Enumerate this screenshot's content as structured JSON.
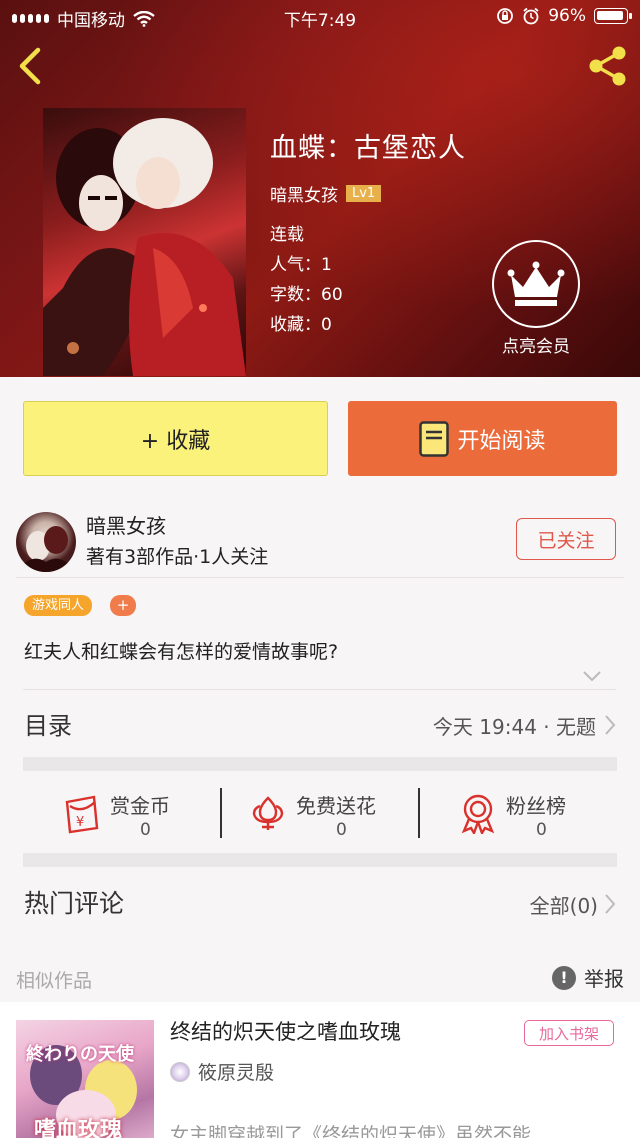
{
  "status_bar": {
    "carrier": "中国移动",
    "time": "下午7:49",
    "battery": "96%"
  },
  "book": {
    "title": "血蝶：古堡恋人",
    "author": "暗黑女孩",
    "level": "Lv1",
    "state": "连载",
    "popularity": "人气：1",
    "word_count": "字数：60",
    "favorites": "收藏：0"
  },
  "vip": {
    "label": "点亮会员"
  },
  "buttons": {
    "collect": "+ 收藏",
    "read": "开始阅读"
  },
  "author_block": {
    "name": "暗黑女孩",
    "stats": "著有3部作品·1人关注",
    "follow": "已关注"
  },
  "tags": [
    "游戏同人"
  ],
  "tag_add": "+",
  "description": "红夫人和红蝶会有怎样的爱情故事呢?",
  "toc": {
    "label": "目录",
    "latest": "今天 19:44 · 无题"
  },
  "actions": [
    {
      "label": "赏金币",
      "count": "0",
      "icon": "coin-envelope-icon"
    },
    {
      "label": "免费送花",
      "count": "0",
      "icon": "flower-icon"
    },
    {
      "label": "粉丝榜",
      "count": "0",
      "icon": "medal-icon"
    }
  ],
  "comments": {
    "label": "热门评论",
    "all": "全部(0)"
  },
  "similar": {
    "label": "相似作品",
    "report": "举报",
    "item": {
      "title": "终结的炽天使之嗜血玫瑰",
      "add": "加入书架",
      "author": "筱原灵殷",
      "desc": "女主脚穿越到了《终结的炽天使》虽然不能...",
      "cover_text_1": "終わりの天使",
      "cover_text_2": "嗜血玫瑰"
    }
  },
  "colors": {
    "accent_orange": "#ec6b3b",
    "collect_yellow": "#fbf27c",
    "follow_red": "#e0584a",
    "tag_orange": "#f5a52b",
    "pink": "#e86a9b"
  }
}
